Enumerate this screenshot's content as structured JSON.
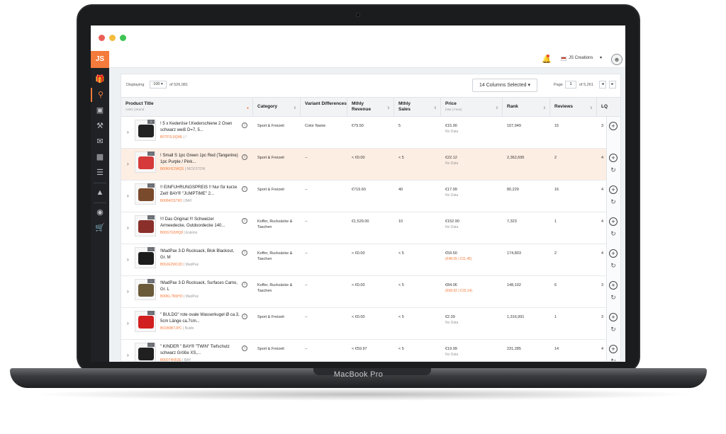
{
  "laptop": {
    "model_label": "MacBook Pro"
  },
  "app": {
    "logo": "JS",
    "account": "JS Creations",
    "sidebar_icons": [
      "gift-icon",
      "search-icon",
      "store-icon",
      "wrench-icon",
      "megaphone-icon",
      "chart-icon",
      "academy-icon",
      "education-icon",
      "globe-icon",
      "cart-icon"
    ]
  },
  "toolbar": {
    "displaying_label": "Displaying",
    "per_page": "100 ▾",
    "total": "of 526,081",
    "columns_button": "14 Columns Selected ▾",
    "page_label": "Page",
    "page_value": "1",
    "page_total": "of 5,261",
    "prev": "◂",
    "next": "▸"
  },
  "columns": {
    "product": {
      "title": "Product Title",
      "sub": "ASIN | Brand"
    },
    "category": "Category",
    "variant": "Variant Differences",
    "revenue": "Mthly Revenue",
    "sales": "Mthly Sales",
    "price": {
      "title": "Price",
      "sub": "(Net | Fees)"
    },
    "rank": "Rank",
    "reviews": "Reviews",
    "lqs": "LQ"
  },
  "rows": [
    {
      "title": "! 5 x Kederöse f.Kederschiene 2 Ösen schwarz weiß D=7, 5...",
      "asin": "B07P2L9QWL",
      "brand": "| !",
      "badge": "1",
      "color": "#222222",
      "category": "Sport & Freizeit",
      "variant": "Color Name",
      "revenue": "€79.50",
      "sales": "5",
      "price": "€15.90",
      "fees": "No Data",
      "rank": "107,949",
      "reviews": "15",
      "lqs": "3"
    },
    {
      "title": "! Small S 1pc Green 1pc Red (Tangerine) 1pc Purple / Pink...",
      "asin": "B00KHZJWQS",
      "brand": "| NICKSTON",
      "badge": "...",
      "color": "#d63a3a",
      "category": "Sport & Freizeit",
      "variant": "--",
      "revenue": "< €0.00",
      "sales": "< 5",
      "price": "€22.12",
      "fees": "No Data",
      "rank": "2,362,695",
      "reviews": "2",
      "lqs": "4"
    },
    {
      "title": "!! EINFÜHRUNGSPREIS !! Nur für kurze Zeit! BAY® \"JUMPTIME\" 2...",
      "asin": "B0084OS79O",
      "brand": "| BAY",
      "badge": "...",
      "color": "#7a4a2c",
      "category": "Sport & Freizeit",
      "variant": "--",
      "revenue": "€719.60",
      "sales": "40",
      "price": "€17.99",
      "fees": "No Data",
      "rank": "80,229",
      "reviews": "16",
      "lqs": "4"
    },
    {
      "title": "!!! Das Original !!! Schweizer Armeedecke, Outdoordecke 140...",
      "asin": "B06S7G5HQ8",
      "brand": "| Eskimo",
      "badge": "...",
      "color": "#8a2f2a",
      "category": "Koffer, Rucksäcke & Taschen",
      "variant": "--",
      "revenue": "€1,529.00",
      "sales": "10",
      "price": "€152.90",
      "fees": "No Data",
      "rank": "7,323",
      "reviews": "1",
      "lqs": "4"
    },
    {
      "title": "!MadPax 3-D Rucksack, Blok Blackout, Gr. M",
      "asin": "B00JE2W13O",
      "brand": "| MadPax",
      "badge": "...",
      "color": "#1c1c1c",
      "category": "Koffer, Rucksäcke & Taschen",
      "variant": "--",
      "revenue": "< €0.00",
      "sales": "< 5",
      "price": "€59.50",
      "fees": "(€48.05 | €11.45)",
      "rank": "174,803",
      "reviews": "2",
      "lqs": "4"
    },
    {
      "title": "!MadPax 3-D Rucksack, Surfaces Camo, Gr. L",
      "asin": "B00KL7N5HO",
      "brand": "| MadPax",
      "badge": "...",
      "color": "#6b5a3a",
      "category": "Koffer, Rucksäcke & Taschen",
      "variant": "--",
      "revenue": "< €0.00",
      "sales": "< 5",
      "price": "€84.06",
      "fees": "(€68.92 | €15.14)",
      "rank": "148,102",
      "reviews": "6",
      "lqs": "3"
    },
    {
      "title": "\" BULDO\" rote ovale Wasserkugel Ø ca.3, 5cm Länge ca.7cm...",
      "asin": "B01B9B7JPC",
      "brand": "| Buldo",
      "badge": "...",
      "color": "#d21f1f",
      "category": "Sport & Freizeit",
      "variant": "--",
      "revenue": "< €0.00",
      "sales": "< 5",
      "price": "€2.39",
      "fees": "No Data",
      "rank": "1,316,991",
      "reviews": "1",
      "lqs": "3"
    },
    {
      "title": "\" KINDER \" BAY® \"TWIN\" Tiefschutz schwarz Größe XS,...",
      "asin": "B00074N53E",
      "brand": "| BAY",
      "badge": "...",
      "color": "#202020",
      "category": "Sport & Freizeit",
      "variant": "--",
      "revenue": "< €59.97",
      "sales": "< 5",
      "price": "€19.99",
      "fees": "No Data",
      "rank": "231,285",
      "reviews": "14",
      "lqs": "4"
    }
  ]
}
